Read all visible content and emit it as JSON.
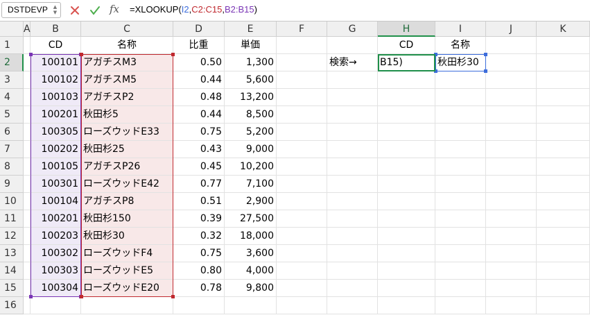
{
  "formula_bar": {
    "name_box": "DSTDEVP",
    "fx_label": "fx",
    "formula_parts": [
      {
        "text": "=XLOOKUP(",
        "color": "#000000"
      },
      {
        "text": "I2",
        "color": "#3d6ddb"
      },
      {
        "text": ",",
        "color": "#000000"
      },
      {
        "text": "C2:C15",
        "color": "#c0292f"
      },
      {
        "text": ",",
        "color": "#000000"
      },
      {
        "text": "B2:B15",
        "color": "#7a35b5"
      },
      {
        "text": ")",
        "color": "#000000"
      }
    ]
  },
  "columns": [
    "A",
    "B",
    "C",
    "D",
    "E",
    "F",
    "G",
    "H",
    "I",
    "J",
    "K"
  ],
  "selected_column": "H",
  "selected_row": 2,
  "rows": [
    {
      "n": "1",
      "B": "CD",
      "C": "名称",
      "D": "比重",
      "E": "単価",
      "G": "",
      "H": "CD",
      "I": "名称"
    },
    {
      "n": "2",
      "B": "100101",
      "C": "アガチスM3",
      "D": "0.50",
      "E": "1,300",
      "G": "検索→",
      "H": "B15)",
      "I": "秋田杉30"
    },
    {
      "n": "3",
      "B": "100102",
      "C": "アガチスM5",
      "D": "0.44",
      "E": "5,600"
    },
    {
      "n": "4",
      "B": "100103",
      "C": "アガチスP2",
      "D": "0.48",
      "E": "13,200"
    },
    {
      "n": "5",
      "B": "100201",
      "C": "秋田杉5",
      "D": "0.44",
      "E": "8,500"
    },
    {
      "n": "6",
      "B": "100305",
      "C": "ローズウッドE33",
      "D": "0.75",
      "E": "5,200"
    },
    {
      "n": "7",
      "B": "100202",
      "C": "秋田杉25",
      "D": "0.43",
      "E": "9,000"
    },
    {
      "n": "8",
      "B": "100105",
      "C": "アガチスP26",
      "D": "0.45",
      "E": "10,200"
    },
    {
      "n": "9",
      "B": "100301",
      "C": "ローズウッドE42",
      "D": "0.77",
      "E": "7,100"
    },
    {
      "n": "10",
      "B": "100104",
      "C": "アガチスP8",
      "D": "0.51",
      "E": "2,900"
    },
    {
      "n": "11",
      "B": "100201",
      "C": "秋田杉150",
      "D": "0.39",
      "E": "27,500"
    },
    {
      "n": "12",
      "B": "100203",
      "C": "秋田杉30",
      "D": "0.32",
      "E": "18,000"
    },
    {
      "n": "13",
      "B": "100302",
      "C": "ローズウッドF4",
      "D": "0.75",
      "E": "3,600"
    },
    {
      "n": "14",
      "B": "100303",
      "C": "ローズウッドE5",
      "D": "0.80",
      "E": "4,000"
    },
    {
      "n": "15",
      "B": "100304",
      "C": "ローズウッドE20",
      "D": "0.78",
      "E": "9,800"
    },
    {
      "n": "16"
    }
  ],
  "colors": {
    "selection_green": "#1f8f4a",
    "ref_blue": "#3d6ddb",
    "ref_red": "#c0292f",
    "ref_purple": "#7a35b5"
  }
}
